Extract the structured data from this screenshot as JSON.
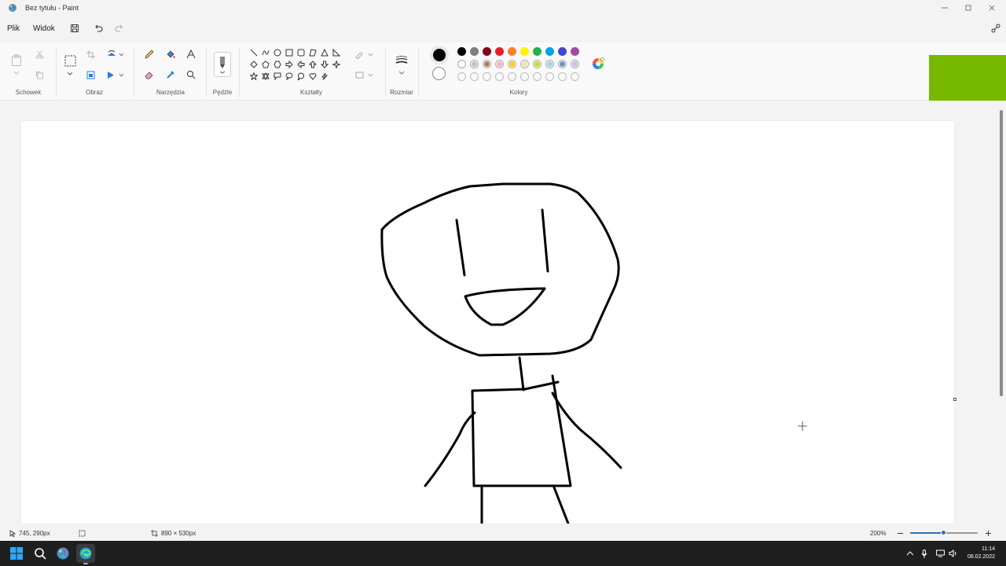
{
  "window": {
    "title": "Bez tytułu - Paint"
  },
  "menu": {
    "file": "Plik",
    "view": "Widok"
  },
  "ribbon": {
    "groups": {
      "clipboard": "Schowek",
      "image": "Obraz",
      "tools": "Narzędzia",
      "brushes": "Pędzle",
      "shapes": "Kształty",
      "size": "Rozmiar",
      "colors": "Kolory"
    },
    "palette_row1": [
      "#000000",
      "#7f7f7f",
      "#880015",
      "#ed1c24",
      "#ff7f27",
      "#fff200",
      "#22b14c",
      "#00a2e8",
      "#3f48cc",
      "#a349a4"
    ],
    "palette_row2": [
      "#ffffff",
      "#c3c3c3",
      "#b97a57",
      "#ffaec9",
      "#ffc90e",
      "#efe4b0",
      "#b5e61d",
      "#99d9ea",
      "#7092be",
      "#c8bfe7"
    ],
    "color1": "#000000",
    "color2": "#ffffff"
  },
  "status": {
    "cursor_pos": "745, 290px",
    "canvas_size": "890 × 530px",
    "zoom": "200%",
    "zoom_level": 0.5
  },
  "taskbar": {
    "time": "11:14",
    "date": "06.02.2022"
  }
}
